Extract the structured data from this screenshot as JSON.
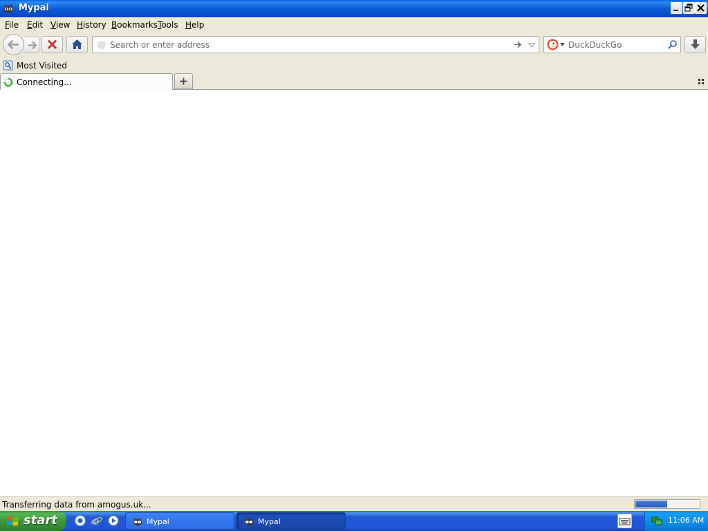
{
  "window": {
    "title": "Mypal"
  },
  "menu": {
    "items": [
      "File",
      "Edit",
      "View",
      "History",
      "Bookmarks",
      "Tools",
      "Help"
    ]
  },
  "navbar": {
    "url_placeholder": "Search or enter address",
    "url_value": "",
    "search_engine": "DuckDuckGo",
    "search_placeholder": "DuckDuckGo"
  },
  "bookmarks": {
    "items": [
      {
        "label": "Most Visited"
      }
    ]
  },
  "tabs": [
    {
      "label": "Connecting...",
      "loading": true
    }
  ],
  "status": {
    "text": "Transferring data from amogus.uk...",
    "progress": 0.5
  },
  "taskbar": {
    "start_label": "start",
    "tasks": [
      {
        "label": "Mypal",
        "active": false
      },
      {
        "label": "Mypal",
        "active": true
      }
    ],
    "clock": "11:06 AM"
  },
  "colors": {
    "titlebar_blue": "#0b5ad8",
    "chrome": "#ece9d8",
    "start_green": "#3a9a3a",
    "stop_red": "#c0392b",
    "spinner_green": "#2fae3c"
  }
}
